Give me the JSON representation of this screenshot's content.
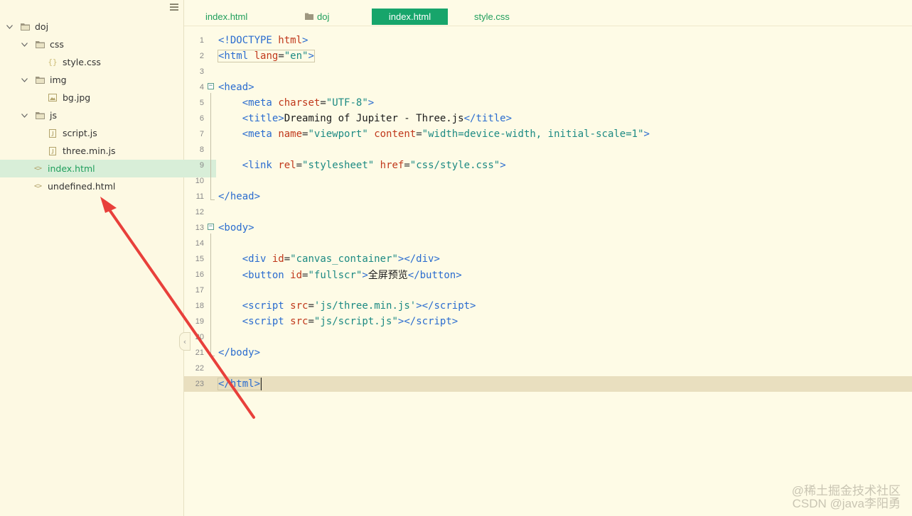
{
  "sidebar": {
    "items": [
      {
        "label": "doj",
        "type": "folder",
        "expanded": true,
        "icon": "folder-icon"
      },
      {
        "label": "css",
        "type": "folder",
        "expanded": true,
        "icon": "folder-icon"
      },
      {
        "label": "style.css",
        "type": "css-file",
        "icon": "braces-file-icon"
      },
      {
        "label": "img",
        "type": "folder",
        "expanded": true,
        "icon": "folder-icon"
      },
      {
        "label": "bg.jpg",
        "type": "image-file",
        "icon": "image-file-icon"
      },
      {
        "label": "js",
        "type": "folder",
        "expanded": true,
        "icon": "folder-icon"
      },
      {
        "label": "script.js",
        "type": "js-file",
        "icon": "js-file-icon"
      },
      {
        "label": "three.min.js",
        "type": "js-file",
        "icon": "js-file-icon"
      },
      {
        "label": "index.html",
        "type": "html-file",
        "icon": "code-file-icon",
        "selected": true
      },
      {
        "label": "undefined.html",
        "type": "html-file",
        "icon": "code-file-icon"
      }
    ]
  },
  "tabs": [
    {
      "label": "index.html",
      "active": false
    },
    {
      "label": "doj",
      "active": false,
      "icon": "folder-icon"
    },
    {
      "label": "index.html",
      "active": true
    },
    {
      "label": "style.css",
      "active": false
    }
  ],
  "editor": {
    "current_line": 23,
    "line_numbers": [
      "1",
      "2",
      "3",
      "4",
      "5",
      "6",
      "7",
      "8",
      "9",
      "10",
      "11",
      "12",
      "13",
      "14",
      "15",
      "16",
      "17",
      "18",
      "19",
      "20",
      "21",
      "22",
      "23"
    ]
  },
  "watermark": {
    "line1": "@稀土掘金技术社区",
    "line2": "CSDN @java李阳勇"
  },
  "colors": {
    "background": "#fefbe6",
    "accent": "#17a56b",
    "selected_row": "#d8eed8",
    "tag": "#2a6ccf",
    "attribute": "#c0381b",
    "string": "#1c8a83",
    "annotation_arrow": "#e8403b"
  }
}
